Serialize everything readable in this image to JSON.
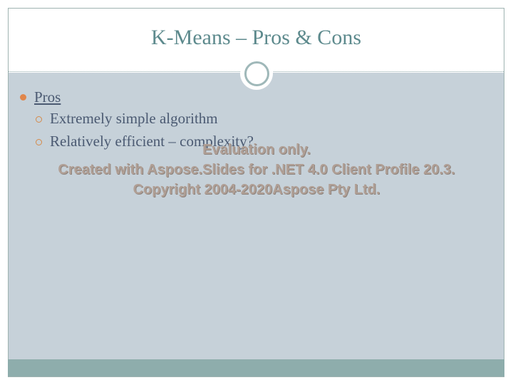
{
  "slide": {
    "title": "K-Means – Pros & Cons",
    "bullets": [
      {
        "label": "Pros",
        "sub": [
          "Extremely simple algorithm",
          "Relatively efficient – complexity?"
        ]
      }
    ]
  },
  "watermark": {
    "line1": "Evaluation only.",
    "line2": "Created with Aspose.Slides for .NET 4.0 Client Profile 20.3.",
    "line3": "Copyright 2004-2020Aspose Pty Ltd."
  },
  "colors": {
    "title": "#5d8a8d",
    "body_text": "#4b5a72",
    "content_bg": "#c6d1d9",
    "footer_bar": "#8eadac",
    "bullet": "#e0864b"
  }
}
